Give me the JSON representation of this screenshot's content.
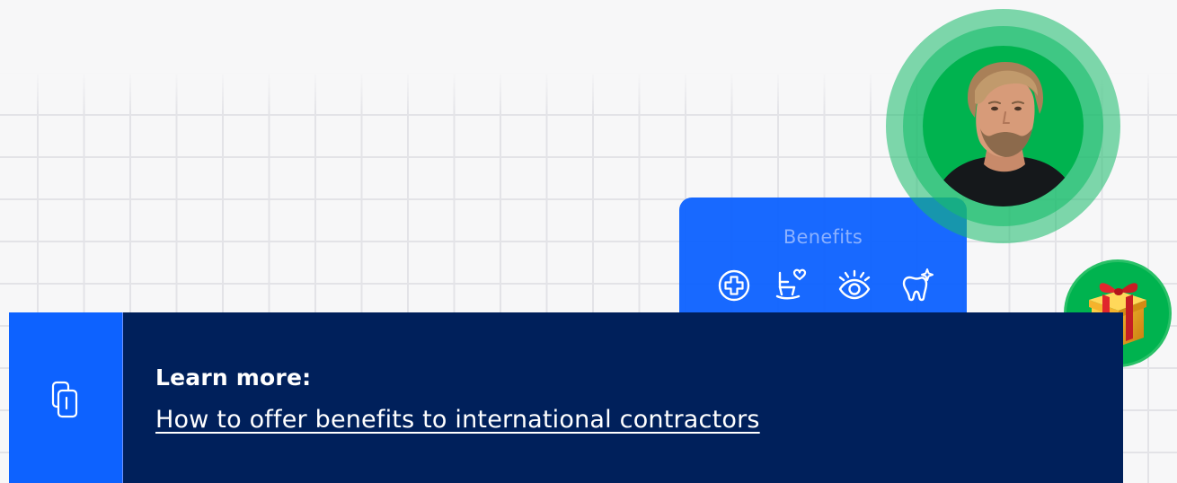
{
  "benefits_card": {
    "title": "Benefits",
    "icons": [
      "medical-cross-icon",
      "rocking-chair-heart-icon",
      "eye-icon",
      "tooth-sparkle-icon"
    ]
  },
  "banner": {
    "label": "Learn more:",
    "link_text": "How to offer benefits to international contractors"
  },
  "colors": {
    "background": "#f7f7f8",
    "banner_navy": "#00205b",
    "accent_blue": "#0d62ff",
    "avatar_green": "#00b34f"
  }
}
